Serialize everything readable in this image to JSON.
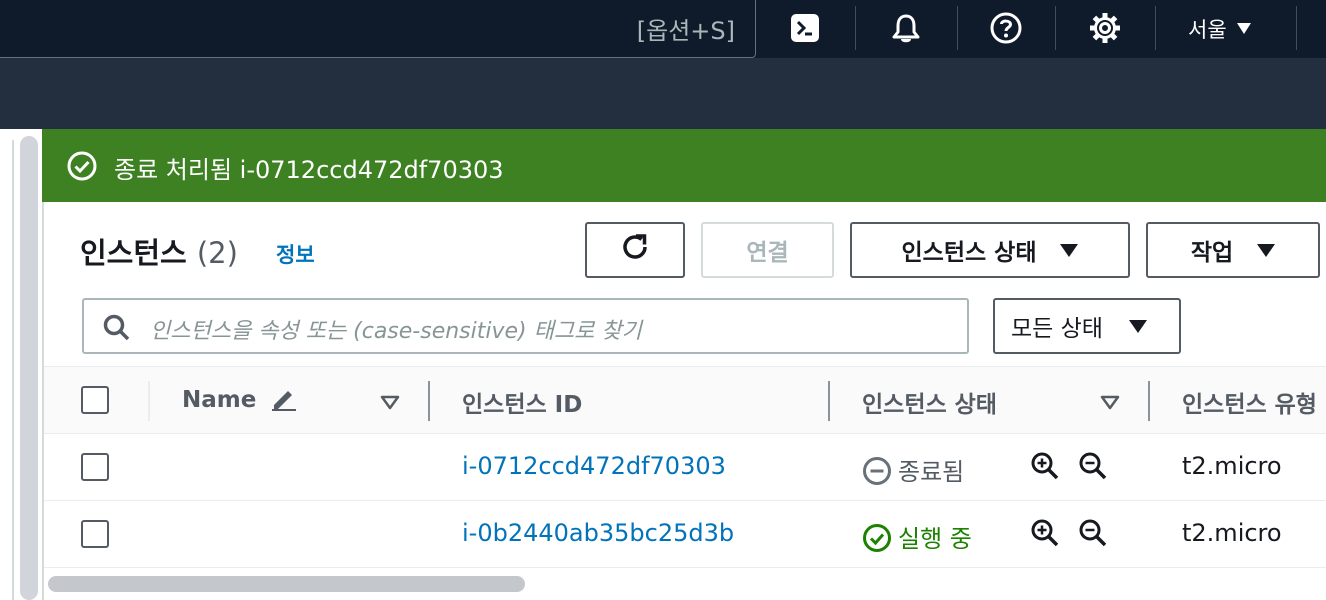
{
  "topnav": {
    "search_shortcut": "[옵션+S]",
    "region": "서울",
    "icons": [
      "cloudshell-icon",
      "bell-icon",
      "help-icon",
      "gear-icon"
    ]
  },
  "flash": {
    "message": "종료 처리됨 i-0712ccd472df70303",
    "color": "#3d8122"
  },
  "instances_panel": {
    "title": "인스턴스",
    "count": "(2)",
    "info_link": "정보",
    "buttons": {
      "refresh": "refresh-icon",
      "connect": "연결",
      "instance_state": "인스턴스 상태",
      "actions": "작업"
    },
    "search_placeholder": "인스턴스을 속성 또는 (case-sensitive) 태그로 찾기",
    "state_filter": "모든 상태"
  },
  "table": {
    "columns": [
      "Name",
      "인스턴스 ID",
      "인스턴스 상태",
      "인스턴스 유형"
    ],
    "rows": [
      {
        "name": "",
        "instance_id": "i-0712ccd472df70303",
        "state": "종료됨",
        "state_kind": "terminated",
        "type": "t2.micro"
      },
      {
        "name": "",
        "instance_id": "i-0b2440ab35bc25d3b",
        "state": "실행 중",
        "state_kind": "running",
        "type": "t2.micro"
      }
    ]
  }
}
